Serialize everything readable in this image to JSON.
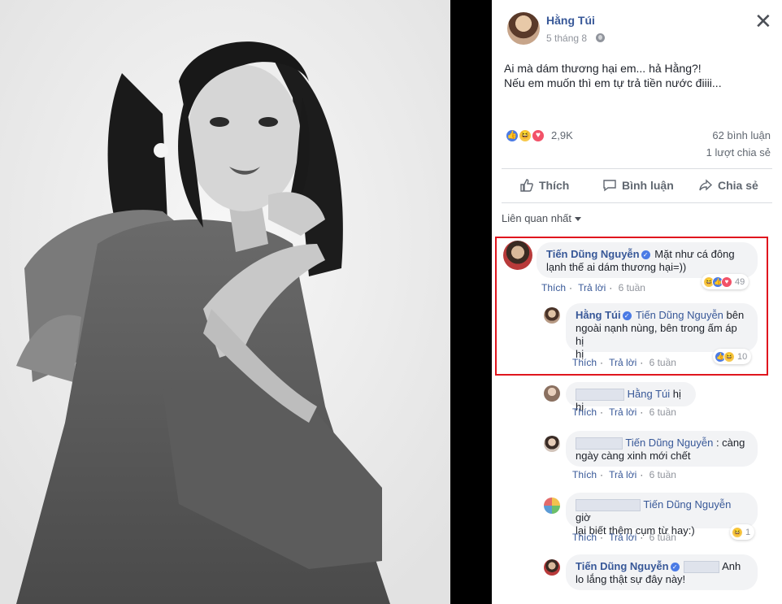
{
  "post": {
    "author": "Hằng Túi",
    "time": "5 tháng 8",
    "close_glyph": "✕",
    "text_lines": [
      "Ai mà dám thương hại em... hả Hằng?!",
      "Nếu em muốn thì em tự trả tiền nước điiii..."
    ],
    "reaction_count": "2,9K",
    "comments_count": "62 bình luận",
    "shares_count": "1 lượt chia sẻ",
    "actions": {
      "like": "Thích",
      "comment": "Bình luận",
      "share": "Chia sẻ"
    },
    "filter_label": "Liên quan nhất"
  },
  "comments": [
    {
      "author": "Tiến Dũng Nguyễn",
      "text_line1": "Mặt như cá đông",
      "text_line2": "lạnh thế ai dám thương hại=))",
      "like": "Thích",
      "reply": "Trả lời",
      "time": "6 tuần",
      "reaction_count": "49"
    },
    {
      "author": "Hằng Túi",
      "mention": "Tiến Dũng Nguyễn",
      "text_line1": "bên",
      "text_line2": "ngoài nạnh nùng, bên trong ấm áp hị",
      "text_line3": "hị",
      "like": "Thích",
      "reply": "Trả lời",
      "time": "6 tuần",
      "reaction_count": "10"
    },
    {
      "mention": "Hằng Túi",
      "text_line1": "hị hị",
      "like": "Thích",
      "reply": "Trả lời",
      "time": "6 tuần"
    },
    {
      "mention": "Tiến Dũng Nguyễn",
      "text_line1": ": càng",
      "text_line2": "ngày càng xinh mới chết",
      "like": "Thích",
      "reply": "Trả lời",
      "time": "6 tuần"
    },
    {
      "mention": "Tiến Dũng Nguyễn",
      "text_line1": "giờ",
      "text_line2": "lại biết thêm cụm từ hay:)",
      "like": "Thích",
      "reply": "Trả lời",
      "time": "6 tuần",
      "reaction_count": "1"
    },
    {
      "author": "Tiến Dũng Nguyễn",
      "text_line1": "Anh",
      "text_line2": "lo lắng thật sự đây này!"
    }
  ],
  "colors": {
    "link": "#385898",
    "highlight": "#e0161e",
    "like": "#4b7be5",
    "haha": "#f7c84b",
    "love": "#f25268"
  },
  "icons": [
    "globe-icon",
    "close-icon",
    "like-icon",
    "comment-icon",
    "share-icon",
    "haha-icon",
    "love-icon",
    "verified-icon"
  ]
}
